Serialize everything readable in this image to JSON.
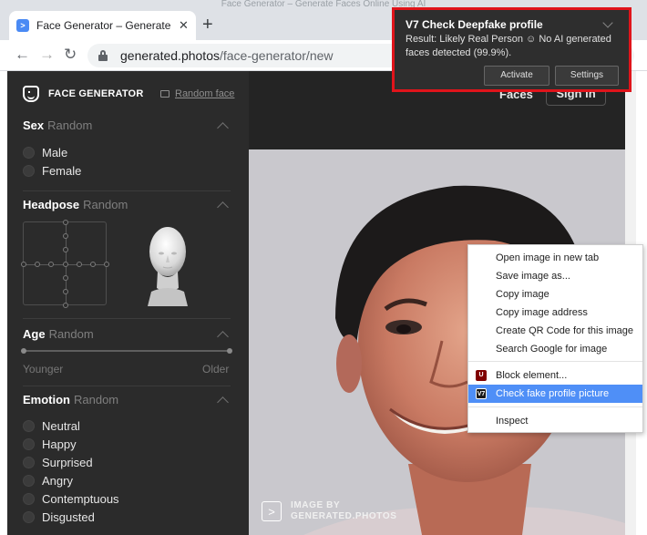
{
  "window": {
    "title": "Face Generator – Generate Faces Online Using AI"
  },
  "browser": {
    "tab_title": "Face Generator – Generate Fac",
    "tab_close": "✕",
    "new_tab": "+",
    "url_host": "generated.photos",
    "url_path": "/face-generator/new"
  },
  "sidebar": {
    "brand": "FACE GENERATOR",
    "random_face": "Random face",
    "sex": {
      "title": "Sex",
      "value": "Random",
      "options": [
        "Male",
        "Female"
      ]
    },
    "headpose": {
      "title": "Headpose",
      "value": "Random"
    },
    "age": {
      "title": "Age",
      "value": "Random",
      "min_label": "Younger",
      "max_label": "Older"
    },
    "emotion": {
      "title": "Emotion",
      "value": "Random",
      "options": [
        "Neutral",
        "Happy",
        "Surprised",
        "Angry",
        "Contemptuous",
        "Disgusted"
      ]
    }
  },
  "main": {
    "nav_faces": "Faces",
    "sign_in": "Sign in",
    "watermark_line1": "IMAGE BY",
    "watermark_line2": "GENERATED.PHOTOS"
  },
  "notification": {
    "title": "V7 Check Deepfake profile",
    "body": "Result: Likely Real Person ☺ No AI generated faces detected (99.9%).",
    "activate": "Activate",
    "settings": "Settings",
    "highlight_color": "#e0141b"
  },
  "context_menu": {
    "items": [
      "Open image in new tab",
      "Save image as...",
      "Copy image",
      "Copy image address",
      "Create QR Code for this image",
      "Search Google for image",
      "Block element...",
      "Check fake profile picture",
      "Inspect"
    ],
    "highlighted": "Check fake profile picture"
  },
  "colors": {
    "sidebar_bg": "#2b2b2b",
    "menu_highlight": "#4f8ff7"
  }
}
